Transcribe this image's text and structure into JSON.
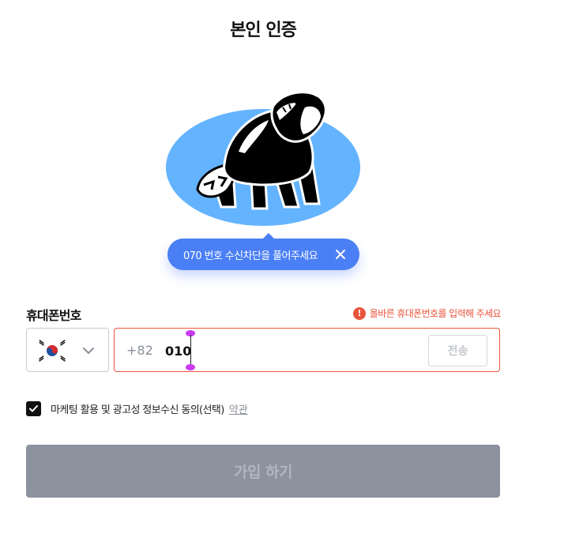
{
  "page": {
    "title": "본인 인증"
  },
  "tooltip": {
    "text": "070 번호 수신차단을 풀어주세요",
    "bg_color": "#4a7ff5"
  },
  "phone": {
    "label": "휴대폰번호",
    "error": "올바른 휴대폰번호를 입력해 주세요",
    "error_color": "#e8543a",
    "country_flag": "south-korea-flag",
    "country_code": "+82",
    "value": "010",
    "send_label": "전송"
  },
  "consent": {
    "checked": true,
    "text": "마케팅 활용 및 광고성 정보수신 동의(선택)",
    "link": "약관"
  },
  "submit": {
    "label": "가입 하기",
    "bg_color": "#8c929e"
  },
  "illustration": {
    "name": "red-panda-illustration",
    "bg_color": "#64b3ff"
  }
}
